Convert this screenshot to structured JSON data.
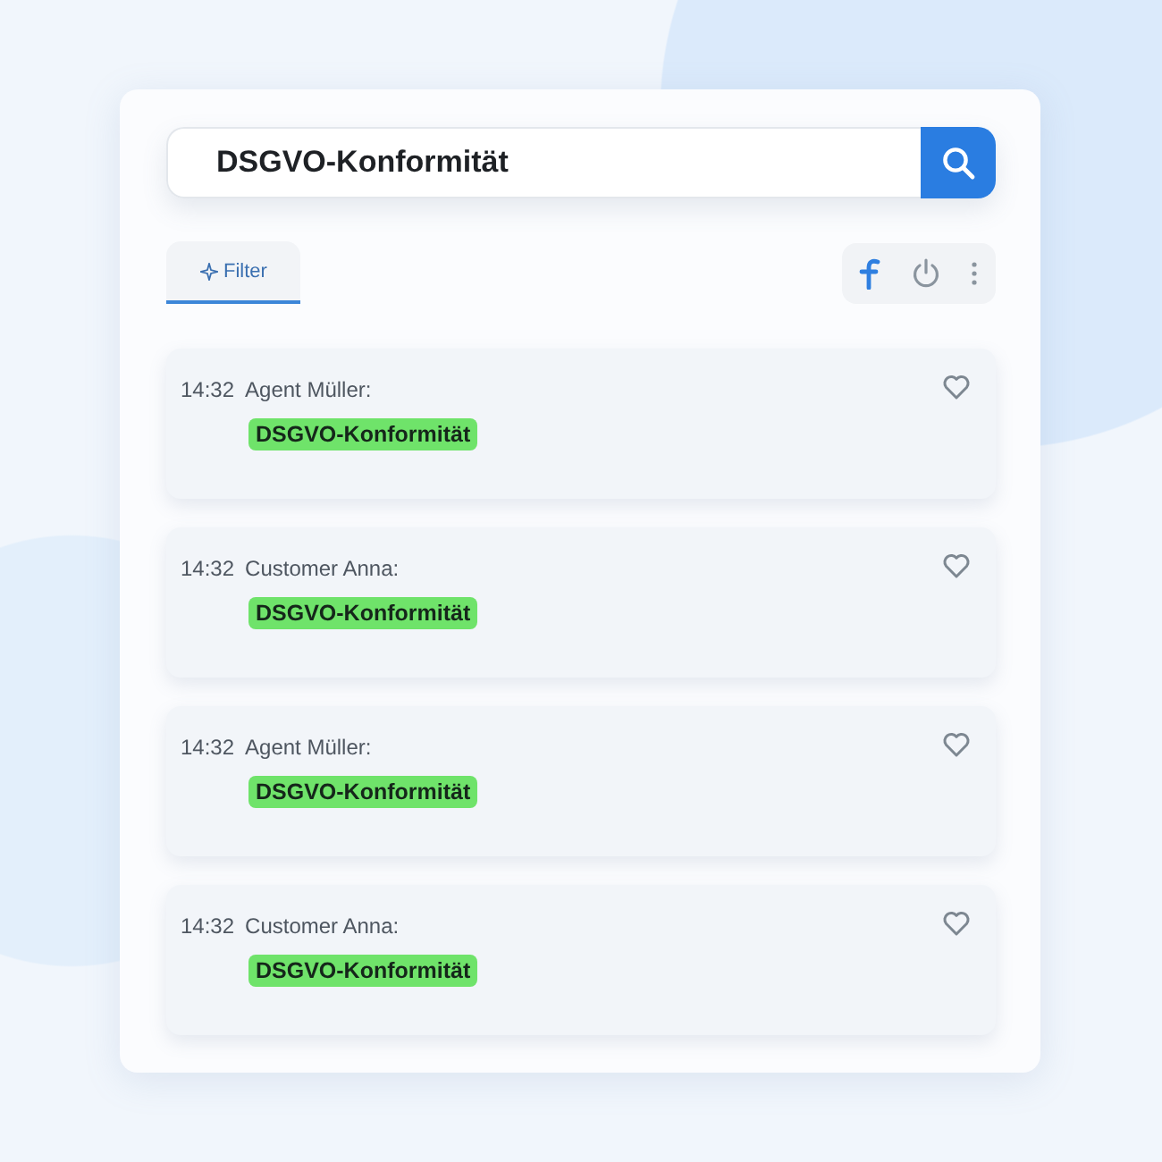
{
  "search": {
    "value": "DSGVO-Konformität"
  },
  "tabs": [
    {
      "label": "Filter",
      "selected": true
    }
  ],
  "messages": [
    {
      "time": "14:32",
      "sender": "Agent Müller:",
      "text": "DSGVO-Konformität",
      "favorite": false
    },
    {
      "time": "14:32",
      "sender": "Customer Anna:",
      "text": "DSGVO-Konformität",
      "favorite": false
    },
    {
      "time": "14:32",
      "sender": "Agent Müller:",
      "text": "DSGVO-Konformität",
      "favorite": false
    },
    {
      "time": "14:32",
      "sender": "Customer Anna:",
      "text": "DSGVO-Konformität",
      "favorite": false
    }
  ]
}
